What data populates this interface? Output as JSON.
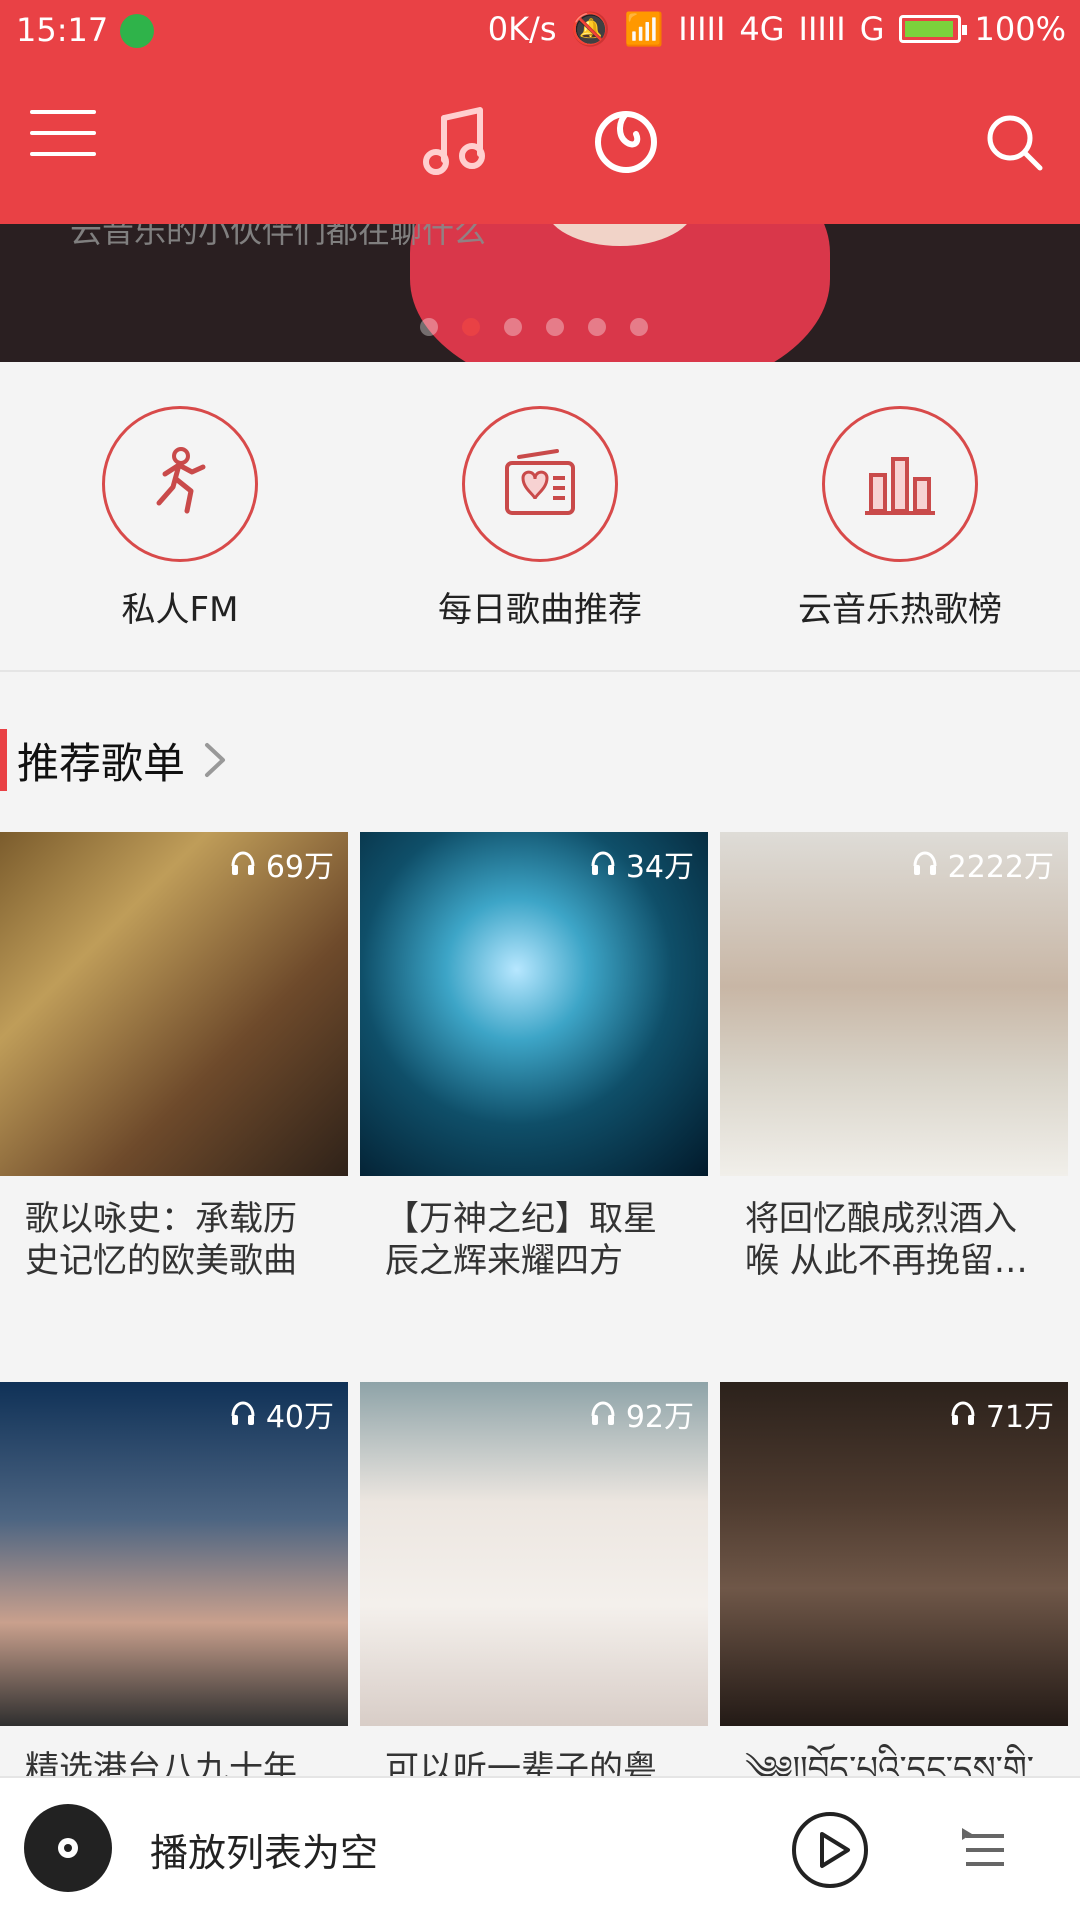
{
  "status": {
    "time": "15:17",
    "network_speed": "0K/s",
    "network_label": "4G",
    "network_label_2": "G",
    "battery_percent": "100%"
  },
  "nav": {
    "menu_icon": "menu-icon",
    "music_icon": "music-note-icon",
    "cloud_icon": "netease-cloud-icon",
    "search_icon": "search-icon"
  },
  "banner": {
    "text": "云音乐的小伙伴们都在聊什么",
    "active_index": 1,
    "dot_count": 6
  },
  "features": [
    {
      "label": "私人FM",
      "icon": "running-person-icon"
    },
    {
      "label": "每日歌曲推荐",
      "icon": "radio-calendar-icon"
    },
    {
      "label": "云音乐热歌榜",
      "icon": "bar-chart-icon"
    }
  ],
  "section": {
    "title": "推荐歌单",
    "arrow": "chevron-right-icon"
  },
  "cards": [
    {
      "count": "69万",
      "title": "歌以咏史：承载历史记忆的欧美歌曲"
    },
    {
      "count": "34万",
      "title": "【万神之纪】取星辰之辉来耀四方"
    },
    {
      "count": "2222万",
      "title": "将回忆酿成烈酒入喉 从此不再挽留…"
    },
    {
      "count": "40万",
      "title": "精选港台八九十年"
    },
    {
      "count": "92万",
      "title": "可以听一辈子的粤"
    },
    {
      "count": "71万",
      "title": "༄༅།།བོད་པའི་དང་དས་གི་"
    }
  ],
  "player": {
    "status_text": "播放列表为空",
    "play_icon": "play-icon",
    "playlist_icon": "playlist-icon",
    "disc_icon": "disc-icon"
  },
  "colors": {
    "accent": "#e94145"
  }
}
